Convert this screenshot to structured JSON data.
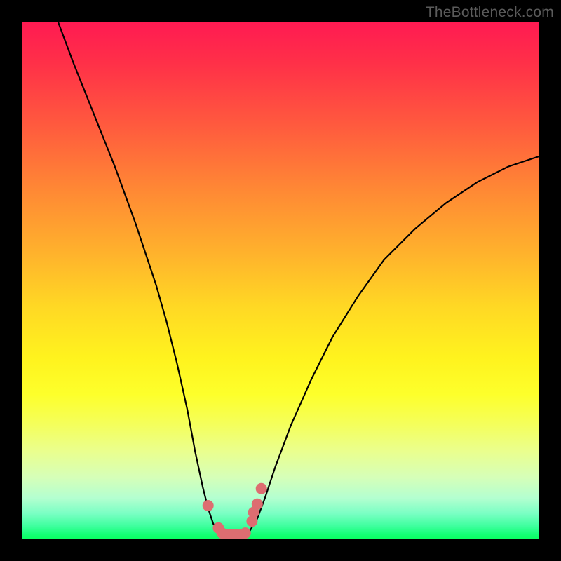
{
  "watermark": "TheBottleneck.com",
  "chart_data": {
    "type": "line",
    "title": "",
    "xlabel": "",
    "ylabel": "",
    "xlim": [
      0,
      100
    ],
    "ylim": [
      0,
      100
    ],
    "series": [
      {
        "name": "bottleneck-curve",
        "x": [
          7,
          10,
          14,
          18,
          22,
          26,
          28,
          30,
          32,
          33.5,
          35,
          36,
          37,
          38,
          39.5,
          41,
          43,
          44,
          45.5,
          47,
          49,
          52,
          56,
          60,
          65,
          70,
          76,
          82,
          88,
          94,
          100
        ],
        "y": [
          100,
          92,
          82,
          72,
          61,
          49,
          42,
          34,
          25,
          17,
          10,
          6,
          3,
          1.5,
          0.8,
          0.8,
          0.8,
          1.5,
          4,
          8,
          14,
          22,
          31,
          39,
          47,
          54,
          60,
          65,
          69,
          72,
          74
        ]
      }
    ],
    "markers": {
      "name": "highlight-points",
      "x": [
        36,
        38,
        38.7,
        39.5,
        40.5,
        41.5,
        42.5,
        43.2,
        44.5,
        44.8,
        45.5,
        46.3
      ],
      "y": [
        6.5,
        2.2,
        1.2,
        0.9,
        0.9,
        0.9,
        0.9,
        1.2,
        3.5,
        5.2,
        6.8,
        9.8
      ]
    },
    "gradient_stops": [
      {
        "pos": 0,
        "color": "#ff1a52"
      },
      {
        "pos": 0.55,
        "color": "#ffd824"
      },
      {
        "pos": 0.78,
        "color": "#f4ff5d"
      },
      {
        "pos": 1.0,
        "color": "#0aff60"
      }
    ]
  }
}
